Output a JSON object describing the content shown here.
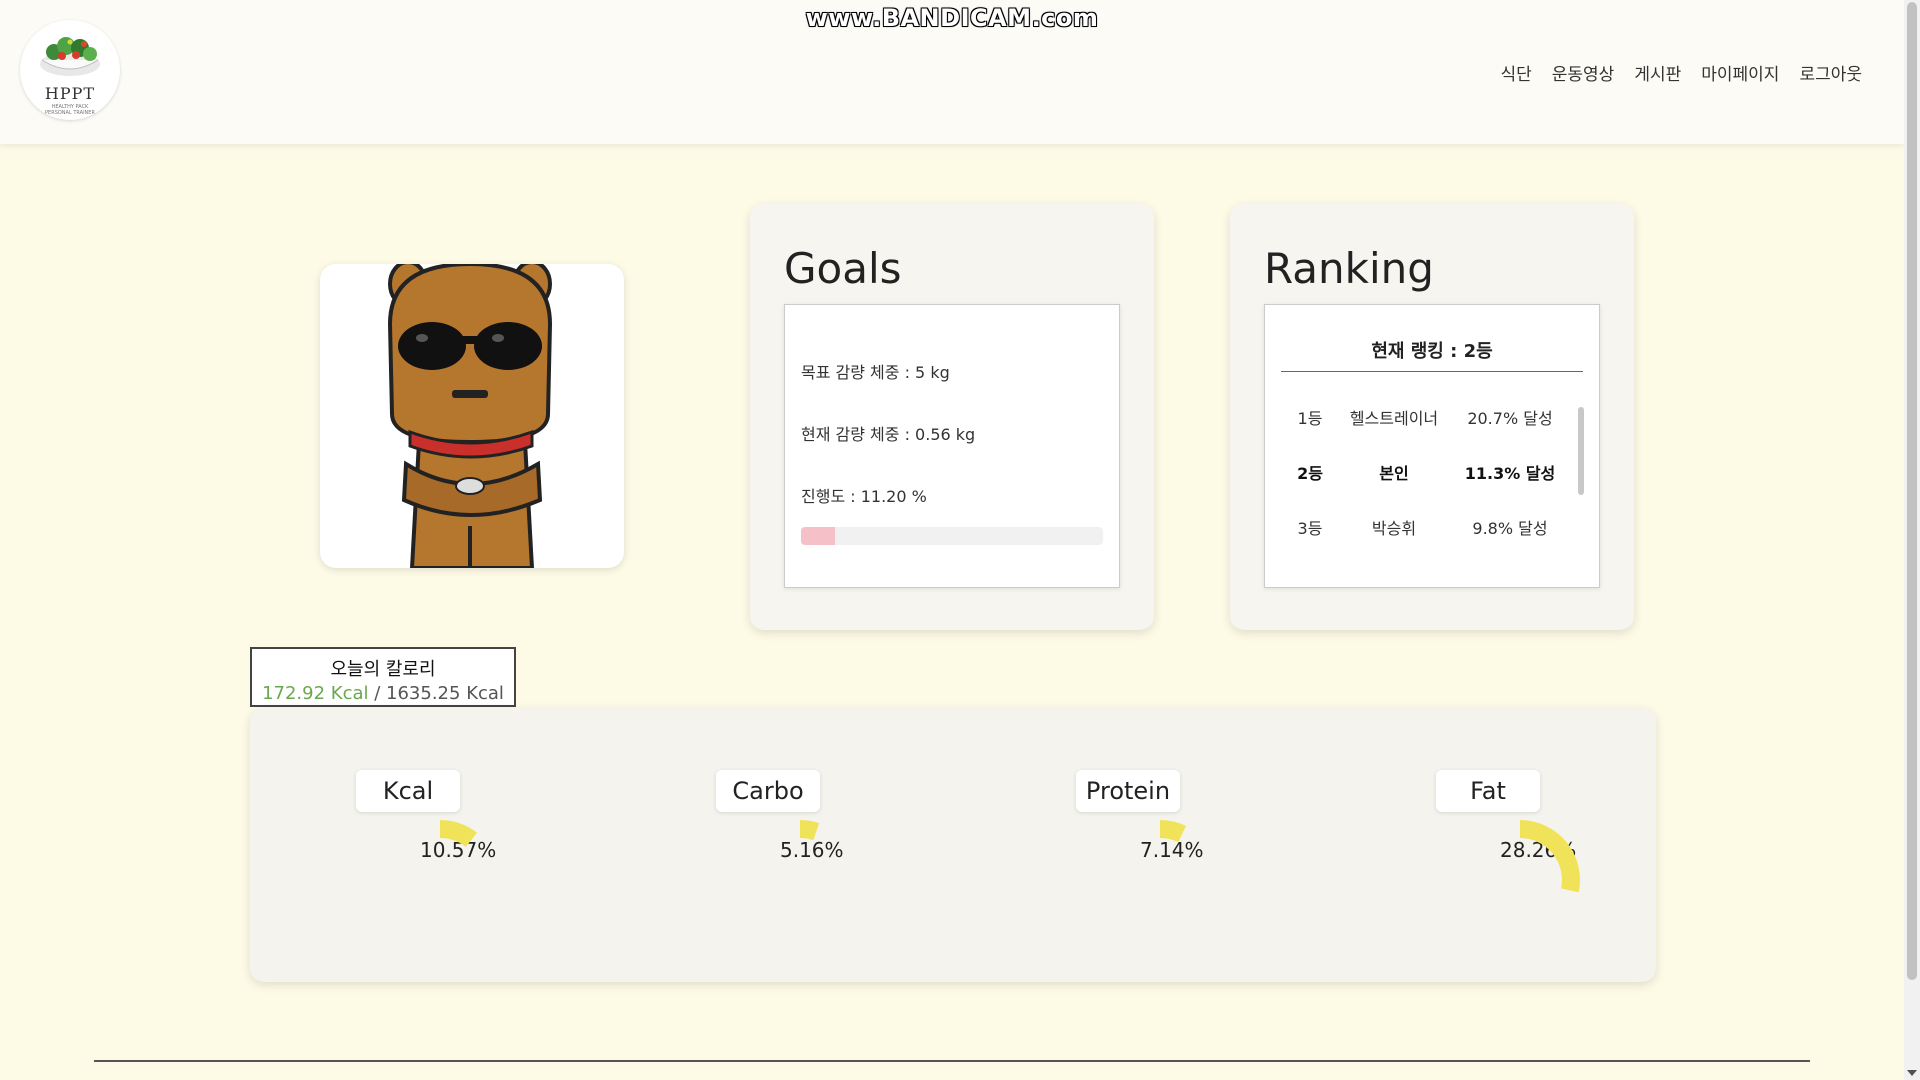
{
  "watermark": "www.BANDICAM.com",
  "logo": {
    "brand": "HPPT",
    "tagline1": "HEALTHY PACK",
    "tagline2": "PERSONAL TRAINER"
  },
  "nav": [
    "식단",
    "운동영상",
    "게시판",
    "마이페이지",
    "로그아웃"
  ],
  "goals": {
    "title": "Goals",
    "target_line": "목표 감량 체중 : 5 kg",
    "current_line": "현재 감량 체중 : 0.56 kg",
    "progress_line": "진행도 : 11.20 %",
    "progress_fraction": 0.112,
    "progress_color": "#f6c0c8"
  },
  "ranking": {
    "title": "Ranking",
    "current": "현재 랭킹 : 2등",
    "rows": [
      {
        "rank": "1등",
        "name": "헬스트레이너",
        "pct": "20.7% 달성"
      },
      {
        "rank": "2등",
        "name": "본인",
        "pct": "11.3% 달성"
      },
      {
        "rank": "3등",
        "name": "박승휘",
        "pct": "9.8% 달성"
      }
    ]
  },
  "calories": {
    "title": "오늘의 칼로리",
    "current": "172.92 Kcal",
    "separator": " / ",
    "total": "1635.25 Kcal"
  },
  "nutrients": [
    {
      "label": "Kcal",
      "pct": "10.57%",
      "value": 10.57
    },
    {
      "label": "Carbo",
      "pct": "5.16%",
      "value": 5.16
    },
    {
      "label": "Protein",
      "pct": "7.14%",
      "value": 7.14
    },
    {
      "label": "Fat",
      "pct": "28.26%",
      "value": 28.26
    }
  ],
  "colors": {
    "accent_green": "#6aa84f",
    "gauge_yellow": "#f0e35a",
    "background": "#fdfbe6"
  }
}
